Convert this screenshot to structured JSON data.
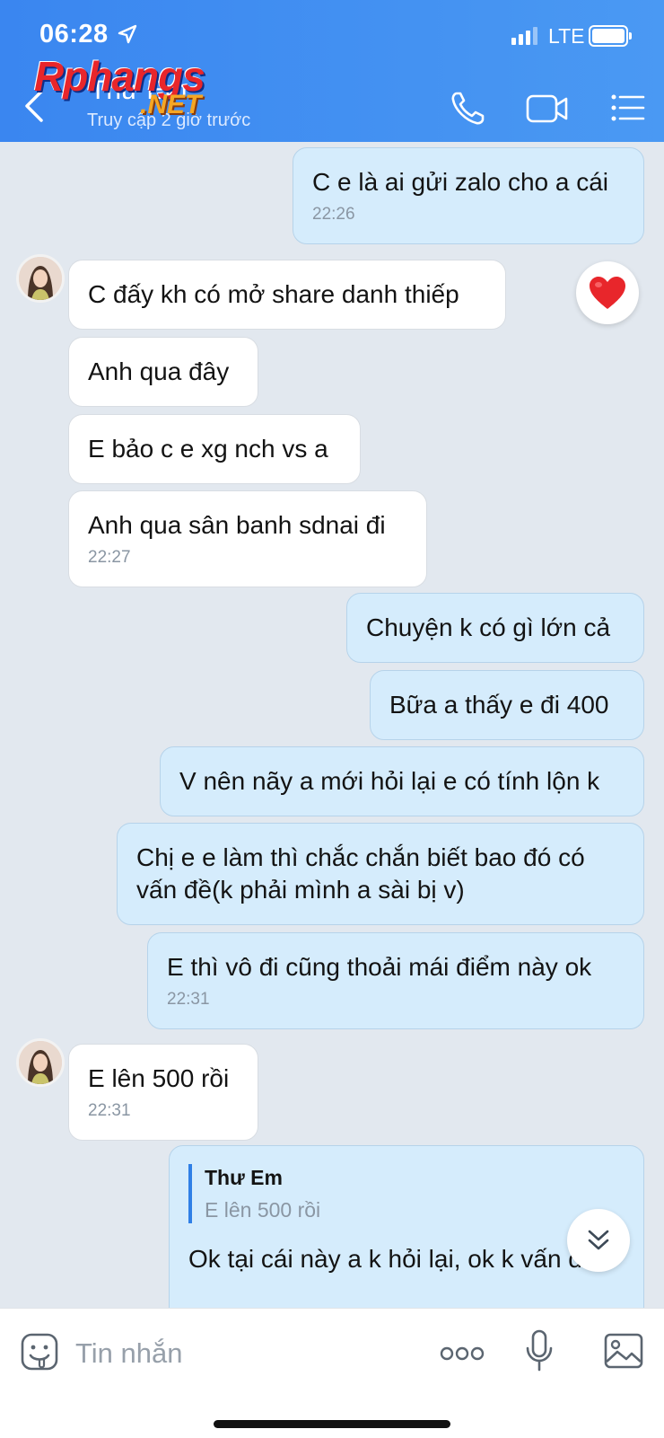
{
  "status_bar": {
    "time": "06:28",
    "network": "LTE"
  },
  "header": {
    "contact_name": "Thư Em",
    "contact_status": "Truy cập 2 giờ trước",
    "icons": [
      "back-chevron-icon",
      "phone-icon",
      "video-call-icon",
      "menu-icon"
    ]
  },
  "watermark": {
    "brand": "Rphangs",
    "suffix": ".NET"
  },
  "messages": [
    {
      "dir": "out",
      "text": "C e là ai gửi zalo cho a cái",
      "time": "22:26"
    },
    {
      "dir": "in",
      "text": "C đấy kh có mở share danh thiếp",
      "reaction": "heart"
    },
    {
      "dir": "in",
      "text": "Anh qua đây"
    },
    {
      "dir": "in",
      "text": "E bảo c e xg nch vs a"
    },
    {
      "dir": "in",
      "text": "Anh qua sân banh sdnai đi",
      "time": "22:27"
    },
    {
      "dir": "out",
      "text": "Chuyện k có gì lớn cả"
    },
    {
      "dir": "out",
      "text": "Bữa a thấy e đi 400"
    },
    {
      "dir": "out",
      "text": "V nên nãy a mới hỏi lại e có tính lộn k"
    },
    {
      "dir": "out",
      "text": "Chị e e làm thì chắc chắn biết bao đó có vấn đề(k phải mình a sài bị v)"
    },
    {
      "dir": "out",
      "text": "E thì vô đi cũng thoải mái điểm này ok",
      "time": "22:31"
    },
    {
      "dir": "in",
      "text": "E lên 500 rồi",
      "time": "22:31"
    },
    {
      "dir": "out",
      "quote_name": "Thư Em",
      "quote_text": "E lên 500 rồi",
      "text": "Ok tại cái này a k hỏi lại, ok k vấn đề"
    }
  ],
  "input": {
    "placeholder": "Tin nhắn"
  },
  "colors": {
    "header": "#3a86f0",
    "out_bubble": "#d5ecfc",
    "in_bubble": "#ffffff",
    "background": "#e2e8ef",
    "heart": "#e8262b"
  }
}
